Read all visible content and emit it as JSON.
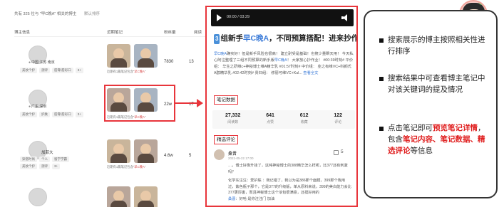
{
  "search": {
    "summary": "共有 325 位与 \"早C晚A\" 相关的博主",
    "sort_label": "默认排序"
  },
  "table": {
    "headers": [
      "博主信息",
      "近期笔记",
      "粉丝量",
      "阅读"
    ]
  },
  "rows": [
    {
      "name": "",
      "location": "中国 江苏 南京",
      "tags": [
        "美妆个护",
        "测评",
        "唇膏/唇彩口",
        "3+"
      ],
      "note_meta_prefix": "近期有1篇笔记包含",
      "note_meta_keyword": "早C晚A",
      "fans": "7830",
      "reads": "13"
    },
    {
      "name": "",
      "location": "广东 深圳",
      "tags": [
        "美妆个护",
        "护肤",
        "唇膏/唇彩口",
        "3+"
      ],
      "note_meta_prefix": "近期有1篇笔记包含",
      "note_meta_keyword": "早C晚A",
      "fans": "22w",
      "reads": "17"
    },
    {
      "name": "加菲大",
      "location": "",
      "tags": [
        "美妆个护",
        "测评",
        "3+"
      ],
      "tags_line1": [
        "穿搭时尚",
        "个人",
        "留学学霸"
      ],
      "note_meta_prefix": "近期有1篇笔记包含",
      "note_meta_keyword": "早C晚A",
      "fans": "4.6w",
      "reads": "5"
    },
    {
      "name": "",
      "location": "",
      "tags": [],
      "note_meta_prefix": "",
      "note_meta_keyword": "",
      "fans": "",
      "reads": ""
    }
  ],
  "detail": {
    "video_time": "00:00 / 03:29",
    "title_num": "3",
    "title_part1": "组新手",
    "title_keyword": "早C晚A",
    "title_part2": "，不同预算搭配！进来抄作业",
    "body_keyword": "早C晚A",
    "body_text": "确实好！但是新手风险也很高！ 建立耐受是基础！也搜少量瞬天用！ 今天私心阿注整理了三组不同预算的新手版",
    "body_keyword2": "早C晚A",
    "body_text2": "！ 大家放心抄作业！ #00:39时刻# 平价组： 华生之研维c+神秘博士维A精华乳 #01:57时刻# 中价组： 韭之有维VC+科颜氏A醇精华乳 #02:42时刻# 贵妇组： 修丽可维VC+Kul...",
    "more_label": "查看全文",
    "data_section_label": "笔记数据",
    "stats": [
      {
        "value": "27,332",
        "label": "阅读数"
      },
      {
        "value": "641",
        "label": "点赞"
      },
      {
        "value": "612",
        "label": "收藏"
      },
      {
        "value": "122",
        "label": "评论"
      }
    ],
    "comments_section_label": "精选评论",
    "comment": {
      "name": "桑晋",
      "time": "2021-05-22 17:00",
      "likes": "5",
      "text": "…，博士好像升挂了，这纯神秘博士的388精华怎么样呢，比377还有刺激吗？",
      "reply_user": "桑晋",
      "reply_text": "化学东注注：爱护肤 ：我记错了，我以为是386那个面膜，399那个我用过，紫色瓶子那个，它是377的升级版，单从原料来说，399的美白能力会比377更厉害，而且神秘博士这个浓包很满意，还挺好用的",
      "reply_tail": "好哈 是你注注门 加油"
    }
  },
  "notes_card": {
    "bullets": [
      {
        "parts": [
          {
            "text": "搜索展示的博主按照相关性进行排序",
            "red": false
          }
        ]
      },
      {
        "parts": [
          {
            "text": "搜索结果中可查看博主笔记中对该关键词的提及情况",
            "red": false
          }
        ]
      },
      {
        "parts": [
          {
            "text": "点击笔记即可",
            "red": false
          },
          {
            "text": "预览笔记详情",
            "red": true
          },
          {
            "text": "，包含",
            "red": false
          },
          {
            "text": "笔记内容、笔记数据、精选评论",
            "red": true
          },
          {
            "text": "等信息",
            "red": false
          }
        ]
      }
    ]
  },
  "colors": {
    "highlight_red": "#e8353b",
    "keyword_blue": "#3b7bd8",
    "emphasis_red": "#e02020"
  }
}
